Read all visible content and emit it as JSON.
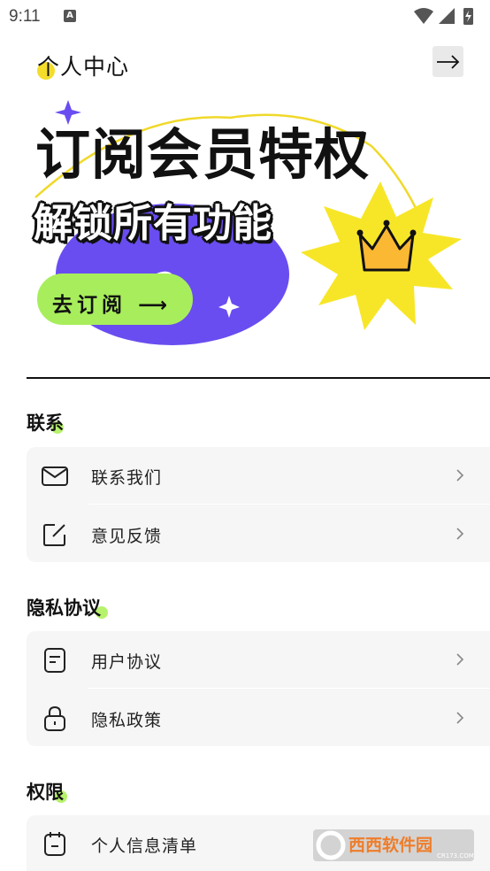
{
  "status_bar": {
    "time": "9:11",
    "notification_letter": "A"
  },
  "header": {
    "title": "个人中心"
  },
  "banner": {
    "title": "订阅会员特权",
    "subtitle": "解锁所有功能",
    "button_label": "去订阅 ⟶",
    "colors": {
      "purple": "#6a4df0",
      "yellow": "#f7e628",
      "green": "#a8ee5c"
    }
  },
  "sections": [
    {
      "title": "联系",
      "items": [
        {
          "label": "联系我们",
          "icon": "mail-icon"
        },
        {
          "label": "意见反馈",
          "icon": "edit-icon"
        }
      ]
    },
    {
      "title": "隐私协议",
      "items": [
        {
          "label": "用户协议",
          "icon": "document-icon"
        },
        {
          "label": "隐私政策",
          "icon": "lock-icon"
        }
      ]
    },
    {
      "title": "权限",
      "items": [
        {
          "label": "个人信息清单",
          "icon": "calendar-icon"
        }
      ]
    }
  ],
  "watermark": {
    "text_main": "西西软件园",
    "text_sub": "CR173.COM"
  }
}
